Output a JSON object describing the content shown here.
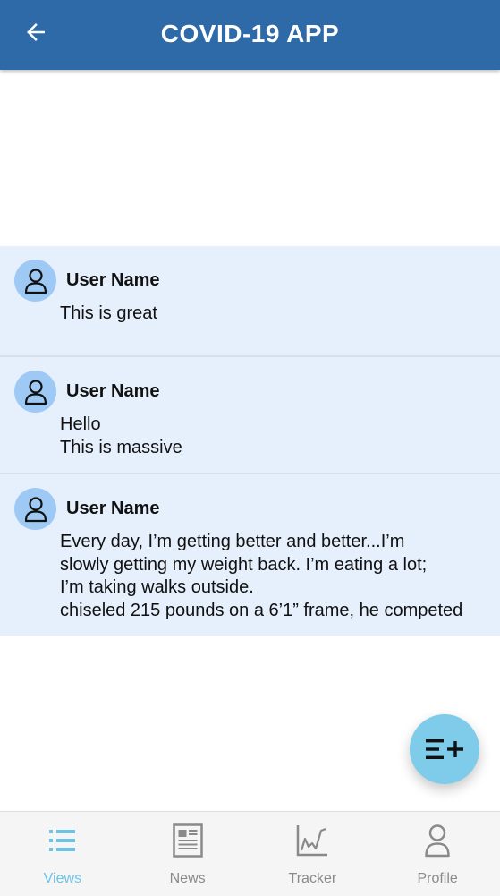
{
  "app_bar": {
    "title": "COVID-19 APP",
    "back_icon": "arrow-left-icon",
    "color": "#2f6aa8"
  },
  "posts": [
    {
      "user": "User Name",
      "lines": [
        "This is great"
      ]
    },
    {
      "user": "User Name",
      "lines": [
        "Hello",
        "This is massive"
      ]
    },
    {
      "user": "User Name",
      "lines": [
        "Every day, I’m getting better and better...I’m",
        "slowly getting my weight back. I’m eating a lot;",
        "I’m taking walks outside.",
        "chiseled 215 pounds on a 6’1” frame, he competed"
      ]
    }
  ],
  "fab": {
    "icon": "add-list-icon",
    "color": "#7ecbea"
  },
  "bottom_nav": {
    "items": [
      {
        "label": "Views",
        "icon": "list-icon",
        "active": true
      },
      {
        "label": "News",
        "icon": "newspaper-icon",
        "active": false
      },
      {
        "label": "Tracker",
        "icon": "chart-icon",
        "active": false
      },
      {
        "label": "Profile",
        "icon": "person-icon",
        "active": false
      }
    ],
    "active_color": "#6cc3e8",
    "inactive_color": "#8a8a8a"
  }
}
